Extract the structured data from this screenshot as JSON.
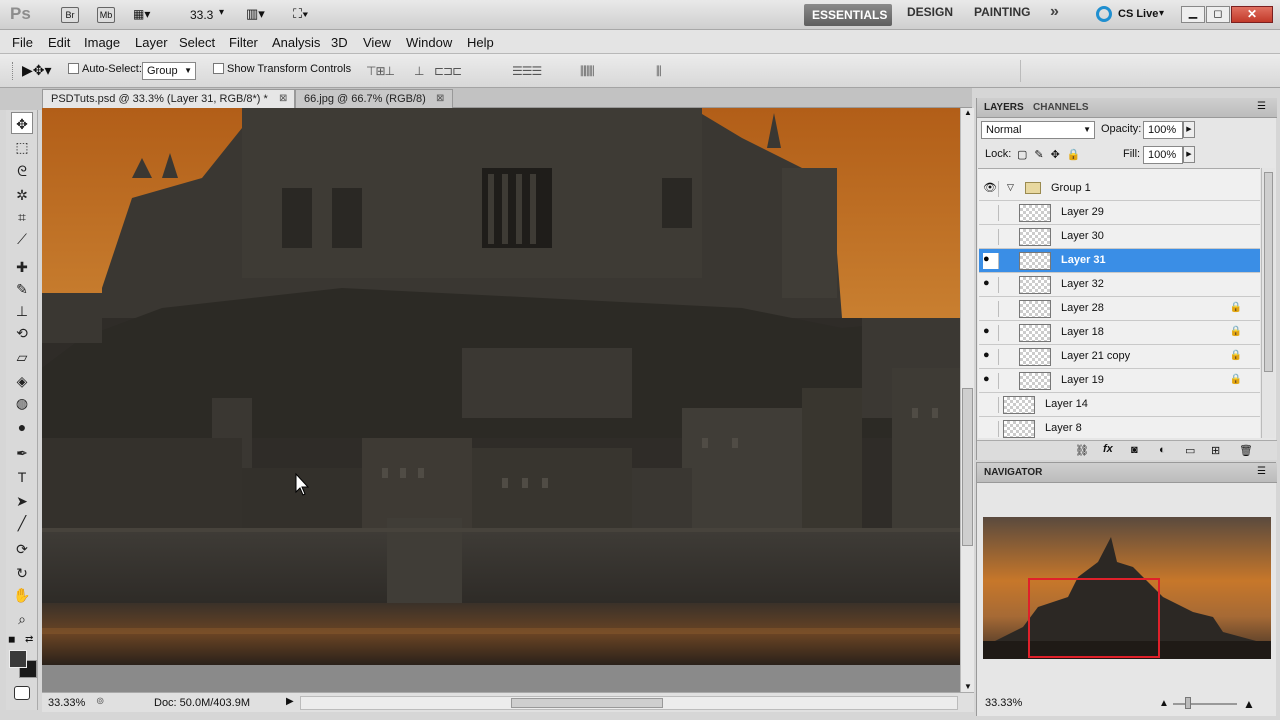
{
  "appbar": {
    "logo": "Ps",
    "br": "Br",
    "mb": "Mb",
    "zoom": "33.3",
    "workspaces": [
      "ESSENTIALS",
      "DESIGN",
      "PAINTING"
    ],
    "more": "»",
    "cslive": "CS Live"
  },
  "menu": [
    "File",
    "Edit",
    "Image",
    "Layer",
    "Select",
    "Filter",
    "Analysis",
    "3D",
    "View",
    "Window",
    "Help"
  ],
  "options": {
    "autoselect_label": "Auto-Select:",
    "autoselect_value": "Group",
    "transform_label": "Show Transform Controls"
  },
  "tabs": [
    {
      "label": "PSDTuts.psd @ 33.3% (Layer 31, RGB/8*) *"
    },
    {
      "label": "66.jpg @ 66.7% (RGB/8)"
    }
  ],
  "status": {
    "zoom": "33.33%",
    "doc": "Doc: 50.0M/403.9M"
  },
  "layers_panel": {
    "tab_layers": "LAYERS",
    "tab_channels": "CHANNELS",
    "blend": "Normal",
    "opacity_label": "Opacity:",
    "opacity": "100%",
    "lock_label": "Lock:",
    "fill_label": "Fill:",
    "fill": "100%",
    "group": "Group 1",
    "layers": [
      {
        "name": "Layer 29",
        "visible": false,
        "locked": false,
        "selected": false
      },
      {
        "name": "Layer 30",
        "visible": false,
        "locked": false,
        "selected": false
      },
      {
        "name": "Layer 31",
        "visible": true,
        "locked": false,
        "selected": true
      },
      {
        "name": "Layer 32",
        "visible": true,
        "locked": false,
        "selected": false
      },
      {
        "name": "Layer 28",
        "visible": false,
        "locked": true,
        "selected": false
      },
      {
        "name": "Layer 18",
        "visible": true,
        "locked": true,
        "selected": false
      },
      {
        "name": "Layer 21 copy",
        "visible": true,
        "locked": true,
        "selected": false
      },
      {
        "name": "Layer 19",
        "visible": true,
        "locked": true,
        "selected": false
      },
      {
        "name": "Layer 14",
        "visible": false,
        "locked": false,
        "selected": false
      },
      {
        "name": "Layer 8",
        "visible": false,
        "locked": false,
        "selected": false
      }
    ]
  },
  "navigator": {
    "title": "NAVIGATOR",
    "zoom": "33.33%"
  },
  "colors": {
    "accent": "#3a8ee6",
    "sky": "#c77a2a",
    "castle": "#3d3a35",
    "nav_frame": "#e0202a"
  }
}
